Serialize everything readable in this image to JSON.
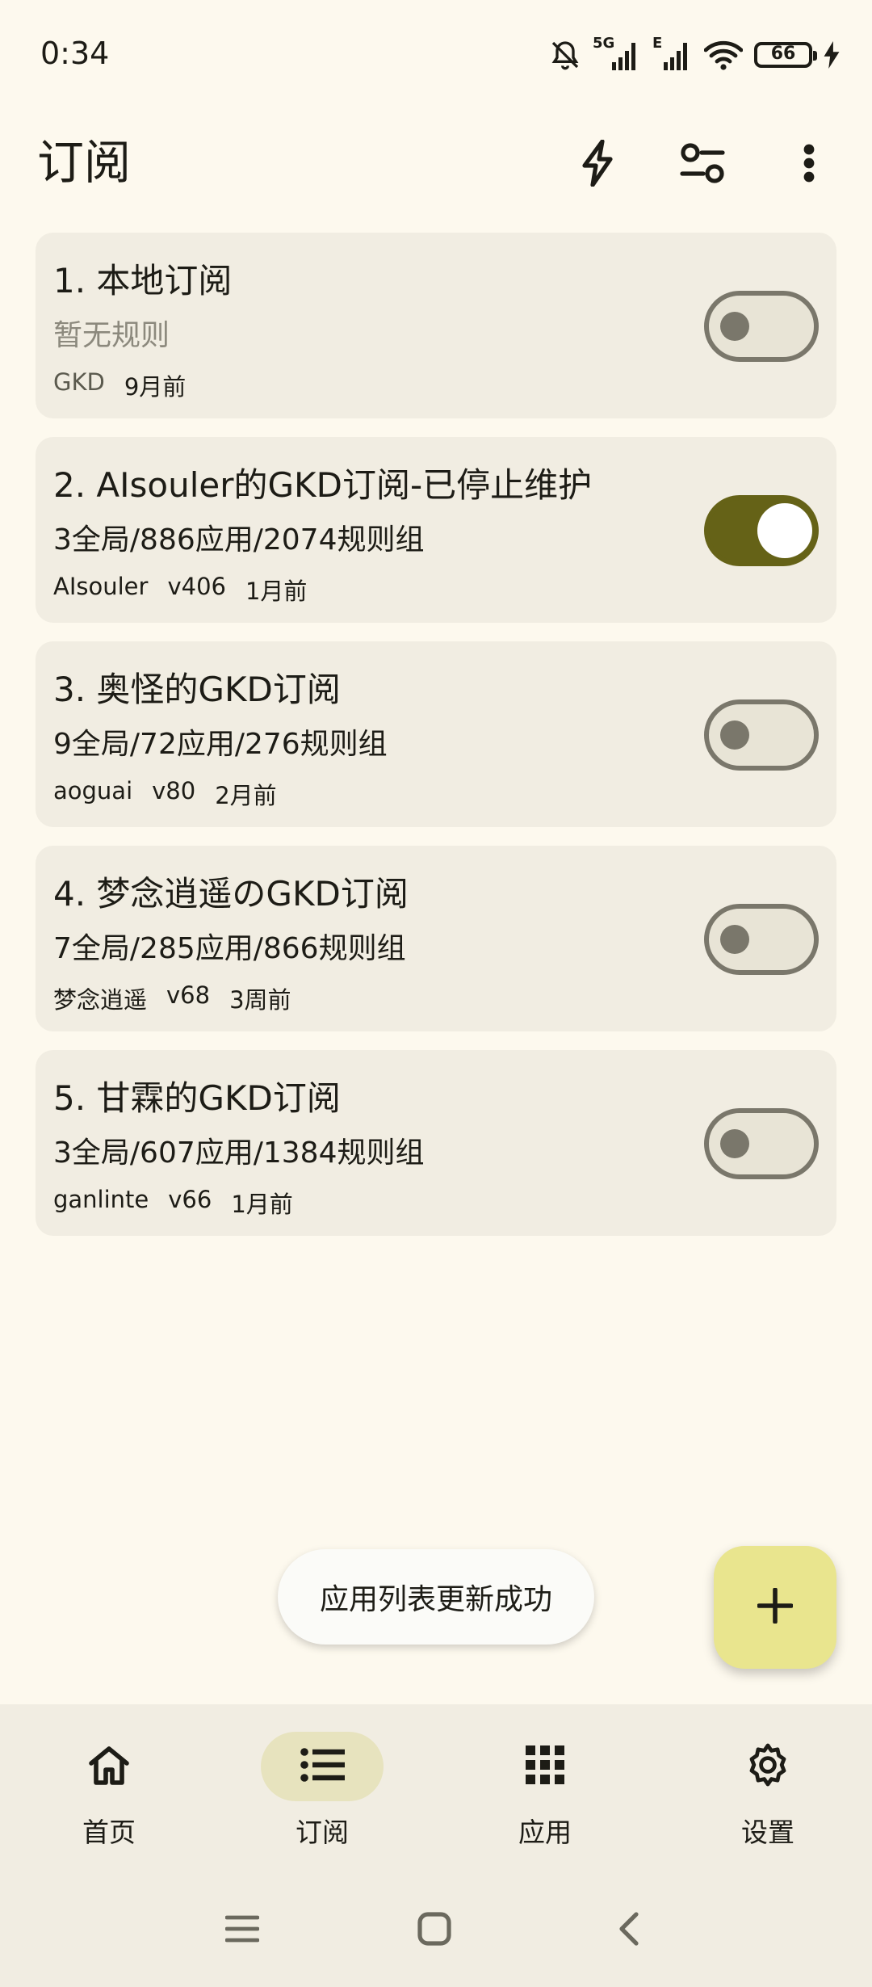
{
  "status_bar": {
    "time": "0:34",
    "network_label": "5G",
    "network_label_2": "E",
    "battery": "66",
    "battery_color": "#57c73a"
  },
  "app_bar": {
    "title": "订阅",
    "actions": [
      {
        "name": "flash-icon"
      },
      {
        "name": "filter-sliders-icon"
      },
      {
        "name": "more-vert-icon"
      }
    ]
  },
  "subscriptions": [
    {
      "title": "1. 本地订阅",
      "summary": "暂无规则",
      "summary_empty": true,
      "author": "GKD",
      "version": "",
      "updated": "9月前",
      "enabled": false
    },
    {
      "title": "2. AIsouler的GKD订阅-已停止维护",
      "summary": "3全局/886应用/2074规则组",
      "summary_empty": false,
      "author": "AIsouler",
      "version": "v406",
      "updated": "1月前",
      "enabled": true
    },
    {
      "title": "3. 奥怪的GKD订阅",
      "summary": "9全局/72应用/276规则组",
      "summary_empty": false,
      "author": "aoguai",
      "version": "v80",
      "updated": "2月前",
      "enabled": false
    },
    {
      "title": "4. 梦念逍遥のGKD订阅",
      "summary": "7全局/285应用/866规则组",
      "summary_empty": false,
      "author": "梦念逍遥",
      "version": "v68",
      "updated": "3周前",
      "enabled": false
    },
    {
      "title": "5. 甘霖的GKD订阅",
      "summary": "3全局/607应用/1384规则组",
      "summary_empty": false,
      "author": "ganlinte",
      "version": "v66",
      "updated": "1月前",
      "enabled": false
    }
  ],
  "toast": {
    "text": "应用列表更新成功"
  },
  "fab": {
    "icon": "plus-icon"
  },
  "bottom_nav": [
    {
      "label": "首页",
      "icon": "home-icon",
      "active": false
    },
    {
      "label": "订阅",
      "icon": "list-icon",
      "active": true
    },
    {
      "label": "应用",
      "icon": "apps-grid-icon",
      "active": false
    },
    {
      "label": "设置",
      "icon": "gear-icon",
      "active": false
    }
  ],
  "colors": {
    "background": "#fdf9ee",
    "card": "#f1ede2",
    "switch_on": "#656217",
    "fab": "#e9e58e",
    "nav_active": "#e7e3be"
  }
}
